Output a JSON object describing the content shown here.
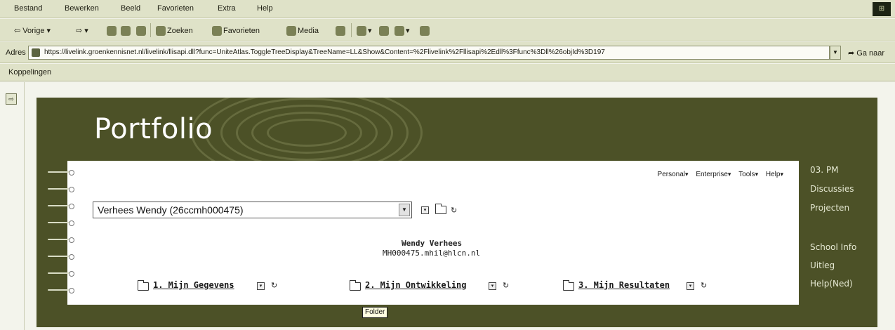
{
  "browser": {
    "menu": [
      "Bestand",
      "Bewerken",
      "Beeld",
      "Favorieten",
      "Extra",
      "Help"
    ],
    "toolbar": {
      "back": "Vorige",
      "search": "Zoeken",
      "favorites": "Favorieten",
      "media": "Media"
    },
    "address": {
      "label": "Adres",
      "url": "https://livelink.groenkennisnet.nl/livelink/llisapi.dll?func=UniteAtlas.ToggleTreeDisplay&TreeName=LL&Show&Content=%2Flivelink%2Fllisapi%2Edll%3Ffunc%3Dll%26objId%3D197",
      "go": "Ga naar"
    },
    "links_label": "Koppelingen"
  },
  "portal": {
    "title": "Portfolio",
    "right_links": [
      "03. PM",
      "Discussies",
      "Projecten",
      "School Info",
      "Uitleg",
      "Help(Ned)"
    ]
  },
  "card": {
    "top_menu": [
      "Personal",
      "Enterprise",
      "Tools",
      "Help"
    ],
    "select_value": "Verhees Wendy (26ccmh000475)",
    "user_name": "Wendy Verhees",
    "user_email": "MH000475.mhil@hlcn.nl",
    "folders": [
      "1. Mijn Gegevens",
      "2. Mijn Ontwikkeling",
      "3. Mijn Resultaten"
    ]
  },
  "tooltip": "Folder",
  "colors": {
    "portal_bg": "#4c5127",
    "chrome_bg": "#dfe2c8",
    "card_bg": "#ffffff"
  }
}
